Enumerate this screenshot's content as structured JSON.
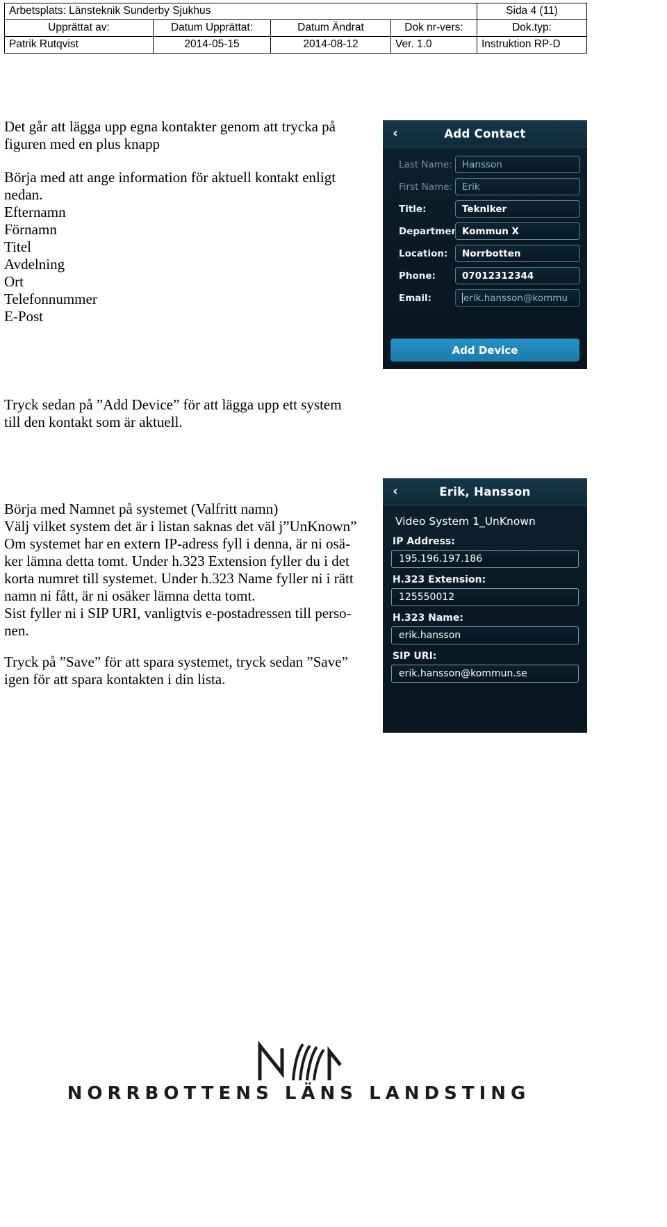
{
  "header": {
    "workplace": "Arbetsplats: Länsteknik Sunderby Sjukhus",
    "page": "Sida 4 (11)",
    "col_labels": {
      "created_by": "Upprättat av:",
      "date_created": "Datum Upprättat:",
      "date_changed": "Datum Ändrat",
      "doc_nr_vers": "Dok nr-vers:",
      "doc_type": "Dok.typ:"
    },
    "col_values": {
      "created_by": "Patrik Rutqvist",
      "date_created": "2014-05-15",
      "date_changed": "2014-08-12",
      "doc_nr_vers": "Ver. 1.0",
      "doc_type": "Instruktion RP-D"
    }
  },
  "body": {
    "para_intro": "Det går att lägga upp egna kontakter genom att trycka på\nfiguren med en plus knapp",
    "para_fields": "Börja med att ange information för aktuell kontakt enligt\nnedan.\nEfternamn\nFörnamn\nTitel\nAvdelning\nOrt\nTelefonnummer\nE-Post",
    "para_adddev": "Tryck sedan på ”Add Device” för att lägga upp ett system\ntill den kontakt som är aktuell.",
    "para_body2": "Börja med Namnet på systemet (Valfritt namn)\nVälj vilket system det är i listan saknas det väl j”UnKnown”\nOm systemet har en extern IP-adress fyll i denna, är ni osä-\nker lämna detta tomt. Under h.323 Extension fyller du i det\nkorta numret till systemet. Under h.323 Name fyller ni i rätt\nnamn ni fått, är ni osäker lämna detta tomt.\nSist fyller ni i SIP URI, vanligtvis e-postadressen till perso-\nnen.",
    "para_save": "Tryck på ”Save” för att spara systemet, tryck sedan ”Save”\nigen för att spara kontakten i din lista."
  },
  "add_contact_panel": {
    "title": "Add Contact",
    "back_icon": "‹",
    "fields": [
      {
        "label": "Last Name:",
        "value": "Hansson",
        "style": "dim"
      },
      {
        "label": "First Name:",
        "value": "Erik",
        "style": "dim"
      },
      {
        "label": "Title:",
        "value": "Tekniker",
        "style": "solid"
      },
      {
        "label": "Department:",
        "value": "Kommun X",
        "style": "solid"
      },
      {
        "label": "Location:",
        "value": "Norrbotten",
        "style": "solid"
      },
      {
        "label": "Phone:",
        "value": "07012312344",
        "style": "solid"
      },
      {
        "label": "Email:",
        "value": "erik.hansson@kommu",
        "style": "placeholder"
      }
    ],
    "add_device_button": "Add Device"
  },
  "device_panel": {
    "title": "Erik, Hansson",
    "back_icon": "‹",
    "system_name": "Video System 1_UnKnown",
    "fields": [
      {
        "label": "IP Address:",
        "value": "195.196.197.186"
      },
      {
        "label": "H.323 Extension:",
        "value": "125550012"
      },
      {
        "label": "H.323 Name:",
        "value": "erik.hansson"
      },
      {
        "label": "SIP URI:",
        "value": "erik.hansson@kommun.se"
      }
    ]
  },
  "footer": {
    "organization": "NORRBOTTENS LÄNS LANDSTING"
  },
  "colors": {
    "panel_dark": "#0a1c27",
    "panel_title": "#16384a",
    "accent_blue": "#2390c4",
    "input_border": "#5f8296",
    "text_light": "#ffffff",
    "text_dim": "#6f93a6"
  }
}
